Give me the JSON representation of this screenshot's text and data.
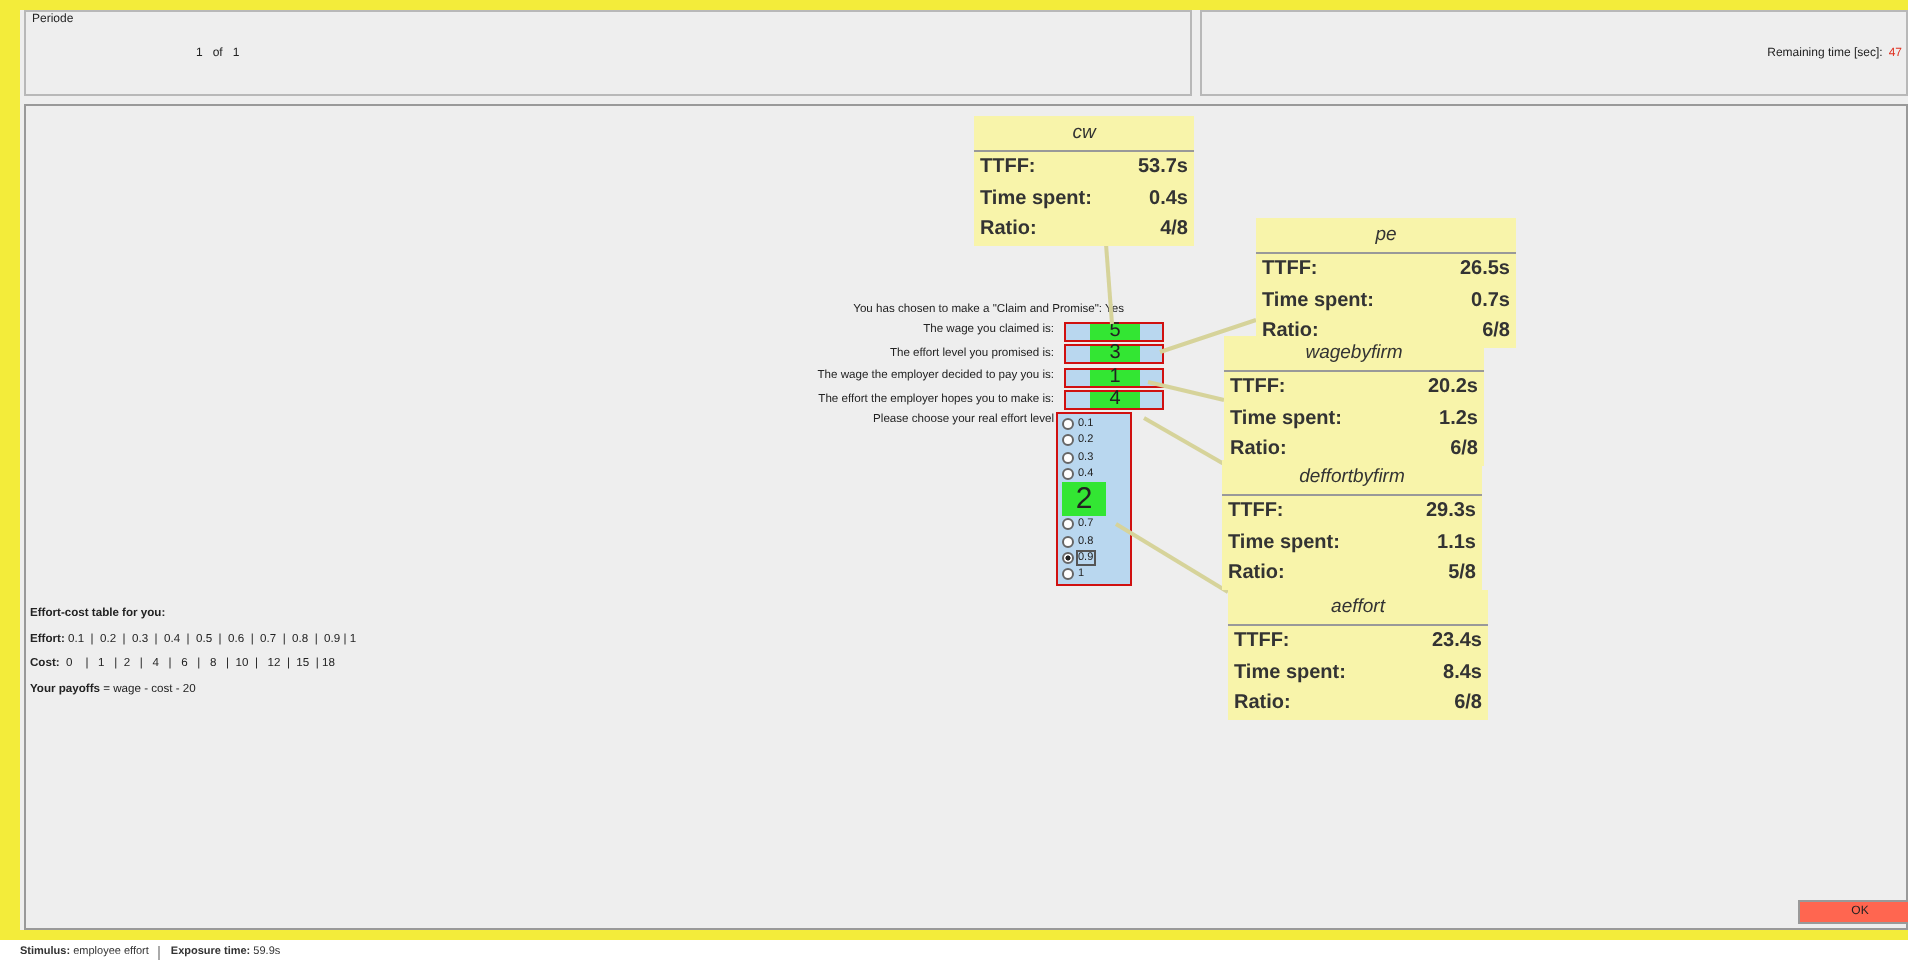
{
  "top_panel": {
    "legend": "Periode",
    "period_text": "1   of   1",
    "remaining_label": "Remaining time [sec]:",
    "remaining_value": "47"
  },
  "form": {
    "claim_text": "You has chosen to make a \"Claim and Promise\": Yes",
    "fields": [
      {
        "label": "The wage you claimed is:",
        "marker": "5"
      },
      {
        "label": "The effort level you promised is:",
        "marker": "3"
      },
      {
        "label": "The wage the employer decided to pay you is:",
        "marker": "1"
      },
      {
        "label": "The effort the employer hopes you to make is:",
        "marker": "4"
      }
    ],
    "radio_label": "Please choose your real effort level",
    "options": [
      {
        "kind": "option",
        "label": "0.1",
        "selected": false
      },
      {
        "kind": "option",
        "label": "0.2",
        "selected": false
      },
      {
        "kind": "option",
        "label": "0.3",
        "selected": false
      },
      {
        "kind": "option",
        "label": "0.4",
        "selected": false
      },
      {
        "kind": "marker",
        "label": "2"
      },
      {
        "kind": "option",
        "label": "0.7",
        "selected": false
      },
      {
        "kind": "option",
        "label": "0.8",
        "selected": false
      },
      {
        "kind": "option",
        "label": "0.9",
        "selected": true
      },
      {
        "kind": "option",
        "label": "1",
        "selected": false
      }
    ]
  },
  "cost_table": {
    "title": "Effort-cost table for you:",
    "lines": [
      "**Effort:** 0.1  |  0.2  |  0.3  |  0.4  |  0.5  |  0.6  |  0.7  |  0.8  |  0.9 | 1",
      "**Cost:**  0    |   1   |  2   |   4   |   6   |   8   |  10  |   12  |  15  | 18",
      "**Your payoffs** = wage - cost - 20"
    ]
  },
  "ok_button": "OK",
  "gaze_cards": [
    {
      "title": "cw",
      "rows": [
        {
          "label": "TTFF:",
          "value": "53.7s"
        },
        {
          "label": "Time spent:",
          "value": "0.4s"
        },
        {
          "label": "Ratio:",
          "value": "4/8"
        }
      ]
    },
    {
      "title": "pe",
      "rows": [
        {
          "label": "TTFF:",
          "value": "26.5s"
        },
        {
          "label": "Time spent:",
          "value": "0.7s"
        },
        {
          "label": "Ratio:",
          "value": "6/8"
        }
      ]
    },
    {
      "title": "wagebyfirm",
      "rows": [
        {
          "label": "TTFF:",
          "value": "20.2s"
        },
        {
          "label": "Time spent:",
          "value": "1.2s"
        },
        {
          "label": "Ratio:",
          "value": "6/8"
        }
      ]
    },
    {
      "title": "deffortbyfirm",
      "rows": [
        {
          "label": "TTFF:",
          "value": "29.3s"
        },
        {
          "label": "Time spent:",
          "value": "1.1s"
        },
        {
          "label": "Ratio:",
          "value": "5/8"
        }
      ]
    },
    {
      "title": "aeffort",
      "rows": [
        {
          "label": "TTFF:",
          "value": "23.4s"
        },
        {
          "label": "Time spent:",
          "value": "8.4s"
        },
        {
          "label": "Ratio:",
          "value": "6/8"
        }
      ]
    }
  ],
  "status_bar": {
    "stimulus": "**Stimulus:** employee effort",
    "exposure": "**Exposure time:** 59.9s"
  }
}
